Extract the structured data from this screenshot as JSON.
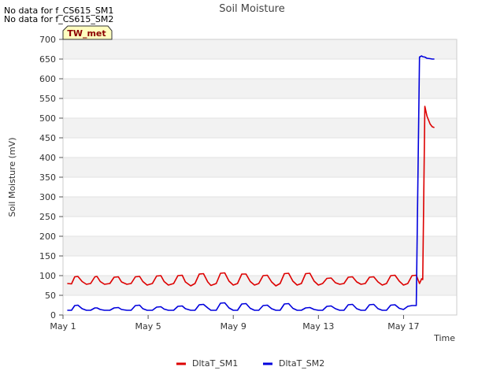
{
  "notes": [
    "No data for f_CS615_SM1",
    "No data for f_CS615_SM2"
  ],
  "badge": {
    "label": "TW_met"
  },
  "chart_data": {
    "type": "line",
    "title": "Soil Moisture",
    "xlabel": "Time",
    "ylabel": "Soil Moisture (mV)",
    "ylim": [
      0,
      700
    ],
    "yticks": [
      0,
      50,
      100,
      150,
      200,
      250,
      300,
      350,
      400,
      450,
      500,
      550,
      600,
      650,
      700
    ],
    "xlim": [
      0,
      18.5
    ],
    "xticks": [
      {
        "value": 0,
        "label": "May 1"
      },
      {
        "value": 4,
        "label": "May 5"
      },
      {
        "value": 8,
        "label": "May 9"
      },
      {
        "value": 12,
        "label": "May 13"
      },
      {
        "value": 16,
        "label": "May 17"
      }
    ],
    "x_unit": "days since May 1",
    "grid": true,
    "legend_position": "bottom-center",
    "series": [
      {
        "name": "DltaT_SM1",
        "color": "#dd0000",
        "x": [
          0.2,
          0.4,
          0.55,
          0.7,
          0.9,
          1.1,
          1.3,
          1.5,
          1.6,
          1.75,
          1.95,
          2.2,
          2.4,
          2.6,
          2.75,
          3.0,
          3.2,
          3.4,
          3.6,
          3.75,
          3.95,
          4.2,
          4.4,
          4.6,
          4.75,
          4.95,
          5.2,
          5.4,
          5.6,
          5.75,
          6.0,
          6.2,
          6.4,
          6.6,
          6.8,
          6.95,
          7.2,
          7.4,
          7.6,
          7.8,
          8.0,
          8.2,
          8.4,
          8.6,
          8.8,
          9.0,
          9.2,
          9.4,
          9.6,
          9.8,
          10.0,
          10.2,
          10.4,
          10.6,
          10.8,
          11.0,
          11.2,
          11.4,
          11.6,
          11.8,
          12.0,
          12.2,
          12.4,
          12.6,
          12.8,
          13.0,
          13.2,
          13.4,
          13.6,
          13.8,
          14.0,
          14.2,
          14.4,
          14.6,
          14.8,
          15.0,
          15.2,
          15.4,
          15.6,
          15.8,
          16.0,
          16.2,
          16.4,
          16.6,
          16.75,
          16.85,
          16.9,
          17.0,
          17.1,
          17.25,
          17.35,
          17.45
        ],
        "values": [
          80,
          79,
          97,
          98,
          85,
          78,
          80,
          97,
          98,
          85,
          78,
          80,
          96,
          97,
          84,
          78,
          80,
          97,
          98,
          85,
          76,
          80,
          99,
          100,
          85,
          76,
          80,
          100,
          101,
          84,
          74,
          80,
          104,
          105,
          84,
          75,
          80,
          106,
          107,
          86,
          76,
          80,
          104,
          104,
          85,
          76,
          80,
          100,
          101,
          84,
          74,
          80,
          105,
          106,
          86,
          76,
          80,
          105,
          106,
          86,
          76,
          80,
          93,
          94,
          82,
          78,
          80,
          96,
          97,
          84,
          78,
          80,
          96,
          97,
          84,
          76,
          80,
          100,
          101,
          86,
          76,
          80,
          100,
          101,
          80,
          92,
          90,
          530,
          505,
          485,
          478,
          476
        ]
      },
      {
        "name": "DltaT_SM2",
        "color": "#0000dd",
        "x": [
          0.2,
          0.4,
          0.55,
          0.7,
          0.9,
          1.1,
          1.3,
          1.5,
          1.6,
          1.75,
          1.95,
          2.2,
          2.4,
          2.6,
          2.75,
          3.0,
          3.2,
          3.4,
          3.6,
          3.75,
          3.95,
          4.2,
          4.4,
          4.6,
          4.75,
          4.95,
          5.2,
          5.4,
          5.6,
          5.75,
          6.0,
          6.2,
          6.4,
          6.6,
          6.8,
          6.95,
          7.2,
          7.4,
          7.6,
          7.8,
          8.0,
          8.2,
          8.4,
          8.6,
          8.8,
          9.0,
          9.2,
          9.4,
          9.6,
          9.8,
          10.0,
          10.2,
          10.4,
          10.6,
          10.8,
          11.0,
          11.2,
          11.4,
          11.6,
          11.8,
          12.0,
          12.2,
          12.4,
          12.6,
          12.8,
          13.0,
          13.2,
          13.4,
          13.6,
          13.8,
          14.0,
          14.2,
          14.4,
          14.6,
          14.8,
          15.0,
          15.2,
          15.4,
          15.6,
          15.8,
          16.0,
          16.2,
          16.4,
          16.6,
          16.75,
          16.85,
          16.9,
          17.0,
          17.1,
          17.25,
          17.35,
          17.45
        ],
        "values": [
          12,
          12,
          24,
          25,
          16,
          12,
          12,
          18,
          18,
          14,
          12,
          12,
          18,
          19,
          14,
          12,
          12,
          24,
          25,
          16,
          12,
          12,
          20,
          21,
          15,
          12,
          12,
          22,
          23,
          16,
          12,
          12,
          26,
          27,
          18,
          12,
          12,
          30,
          31,
          18,
          12,
          12,
          28,
          29,
          17,
          12,
          12,
          24,
          25,
          16,
          12,
          12,
          28,
          29,
          17,
          12,
          12,
          18,
          19,
          14,
          12,
          12,
          22,
          23,
          16,
          12,
          12,
          26,
          27,
          16,
          12,
          12,
          26,
          27,
          16,
          12,
          12,
          25,
          26,
          17,
          14,
          22,
          24,
          24,
          655,
          658,
          656,
          655,
          652,
          651,
          650,
          650
        ]
      }
    ]
  }
}
